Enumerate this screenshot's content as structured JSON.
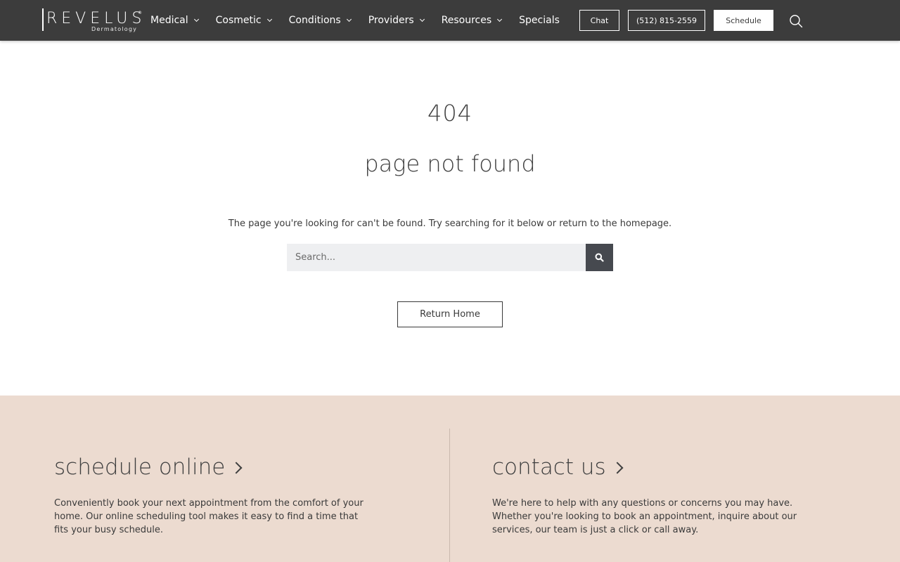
{
  "header": {
    "logo_text": "REVELUS",
    "logo_subtext": "Dermatology",
    "logo_mark": "®",
    "nav": [
      {
        "label": "Medical",
        "has_dropdown": true
      },
      {
        "label": "Cosmetic",
        "has_dropdown": true
      },
      {
        "label": "Conditions",
        "has_dropdown": true
      },
      {
        "label": "Providers",
        "has_dropdown": true
      },
      {
        "label": "Resources",
        "has_dropdown": true
      },
      {
        "label": "Specials",
        "has_dropdown": false
      }
    ],
    "chat_label": "Chat",
    "phone_label": "(512) 815-2559",
    "schedule_label": "Schedule",
    "search_icon": "search-icon"
  },
  "main": {
    "code": "404",
    "title": "page not found",
    "description": "The page you're looking for can't be found. Try searching for it below or return to the homepage.",
    "search": {
      "placeholder": "Search...",
      "value": "",
      "button_icon": "search-icon"
    },
    "return_label": "Return Home"
  },
  "cta": {
    "left": {
      "title": "schedule online",
      "text": "Conveniently book your next appointment from the comfort of your home. Our online scheduling tool makes it easy to find a time that fits your busy schedule."
    },
    "right": {
      "title": "contact us",
      "text": "We're here to help with any questions or concerns you may have. Whether you're looking to book an appointment, inquire about our services, our team is just a click or call away."
    }
  },
  "colors": {
    "header_bg": "#3c3c3c",
    "cta_bg": "#ecdbd0",
    "search_button_bg": "#46494f",
    "search_input_bg": "#eeeff1"
  }
}
